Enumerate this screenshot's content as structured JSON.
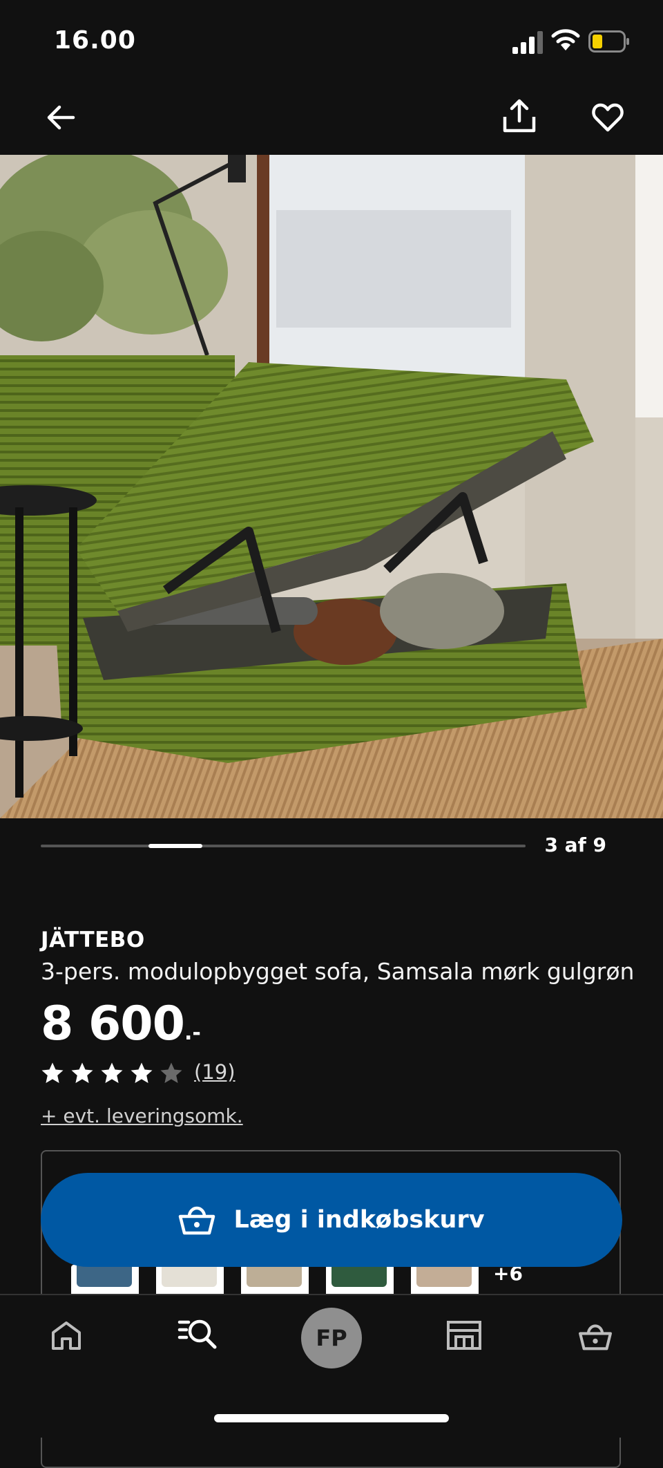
{
  "status_bar": {
    "time": "16.00"
  },
  "gallery": {
    "counter": "3 af 9",
    "current": 3,
    "total": 9
  },
  "product": {
    "brand": "JÄTTEBO",
    "description": "3-pers. modulopbygget sofa, Samsala mørk gulgrøn",
    "price_main": "8 600",
    "price_suffix": ".-",
    "rating": 4,
    "rating_max": 5,
    "review_count": "(19)",
    "delivery_link": "+ evt. leveringsomk."
  },
  "cart": {
    "label": "Læg i indkøbskurv"
  },
  "variants": {
    "more_label": "+6",
    "swatch_colors": [
      "#3d6686",
      "#e4e0d6",
      "#bdae96",
      "#2f5b3e",
      "#c3ad96"
    ]
  },
  "tabbar": {
    "avatar_initials": "FP"
  },
  "colors": {
    "accent": "#0058a3",
    "background": "#111111"
  }
}
